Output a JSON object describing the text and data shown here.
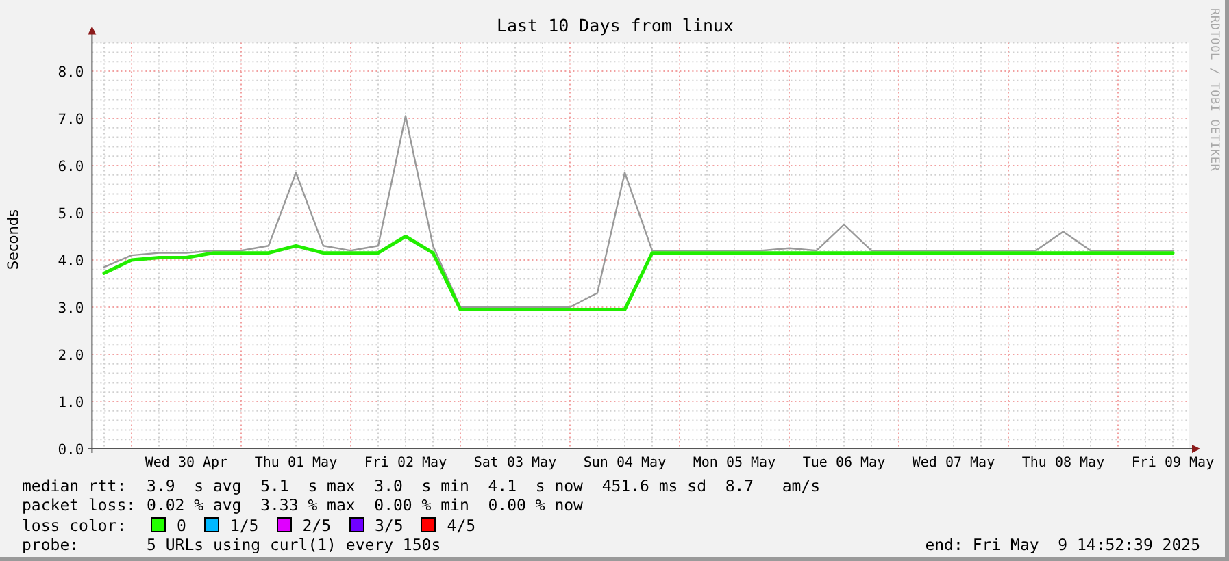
{
  "title": "Last 10 Days from linux",
  "credit": "RRDTOOL / TOBI OETIKER",
  "chart": {
    "chart_data": {
      "type": "line",
      "ylabel": "Seconds",
      "categories": [
        null,
        null,
        null,
        "Wed 30 Apr",
        null,
        null,
        null,
        "Thu 01 May",
        null,
        null,
        null,
        "Fri 02 May",
        null,
        null,
        null,
        "Sat 03 May",
        null,
        null,
        null,
        "Sun 04 May",
        null,
        null,
        null,
        "Mon 05 May",
        null,
        null,
        null,
        "Tue 06 May",
        null,
        null,
        null,
        "Wed 07 May",
        null,
        null,
        null,
        "Thu 08 May",
        null,
        null,
        null,
        "Fri 09 May"
      ],
      "series": [
        {
          "color": "#999999",
          "values": [
            3.85,
            4.1,
            4.15,
            4.15,
            4.2,
            4.2,
            4.3,
            5.85,
            4.3,
            4.2,
            4.3,
            7.05,
            4.3,
            3.0,
            3.0,
            3.0,
            3.0,
            3.0,
            3.3,
            5.85,
            4.2,
            4.2,
            4.2,
            4.2,
            4.2,
            4.25,
            4.2,
            4.75,
            4.2,
            4.2,
            4.2,
            4.2,
            4.2,
            4.2,
            4.2,
            4.6,
            4.2,
            4.2,
            4.2,
            4.2
          ]
        },
        {
          "color": "#22ee00",
          "values": [
            3.72,
            4.0,
            4.05,
            4.05,
            4.15,
            4.15,
            4.15,
            4.3,
            4.15,
            4.15,
            4.15,
            4.5,
            4.15,
            2.95,
            2.95,
            2.95,
            2.95,
            2.95,
            2.95,
            2.95,
            4.15,
            4.15,
            4.15,
            4.15,
            4.15,
            4.15,
            4.15,
            4.15,
            4.15,
            4.15,
            4.15,
            4.15,
            4.15,
            4.15,
            4.15,
            4.15,
            4.15,
            4.15,
            4.15,
            4.15
          ]
        }
      ],
      "grid": true,
      "ylim": [
        0,
        8.6
      ],
      "yticks": [
        {
          "value": 0,
          "label": "0.0"
        },
        {
          "value": 1,
          "label": "1.0"
        },
        {
          "value": 2,
          "label": "2.0"
        },
        {
          "value": 3,
          "label": "3.0"
        },
        {
          "value": 4,
          "label": "4.0"
        },
        {
          "value": 5,
          "label": "5.0"
        },
        {
          "value": 6,
          "label": "6.0"
        },
        {
          "value": 7,
          "label": "7.0"
        },
        {
          "value": 8,
          "label": "8.0"
        }
      ]
    }
  },
  "legend": {
    "stats": [
      {
        "label": "median rtt:",
        "text": "3.9  s avg  5.1  s max  3.0  s min  4.1  s now  451.6 ms sd  8.7   am/s"
      },
      {
        "label": "packet loss:",
        "text": "0.02 % avg  3.33 % max  0.00 % min  0.00 % now"
      }
    ],
    "loss_color": {
      "label": "loss color:",
      "items": [
        {
          "label": "0",
          "color": "#22ff00"
        },
        {
          "label": "1/5",
          "color": "#00b8ff"
        },
        {
          "label": "2/5",
          "color": "#e000ff"
        },
        {
          "label": "3/5",
          "color": "#7000ff"
        },
        {
          "label": "4/5",
          "color": "#ff0000"
        }
      ]
    },
    "probe": {
      "label": "probe:",
      "text": "5 URLs using curl(1) every 150s"
    },
    "end": "end: Fri May  9 14:52:39 2025"
  }
}
